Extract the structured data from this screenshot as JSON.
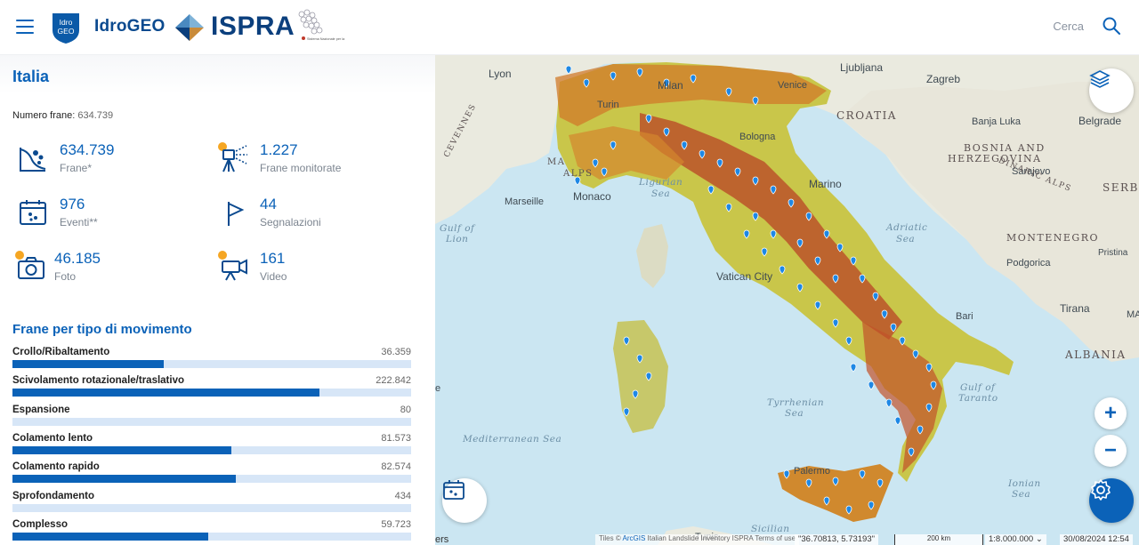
{
  "header": {
    "idrogeo_logo_text": [
      "Idro",
      "GEO"
    ],
    "app_name": "IdroGEO",
    "ispra_name": "ISPRA",
    "snpa_text": "Sistema Nazionale per la Protezione dell'Ambiente",
    "search_label": "Cerca"
  },
  "panel": {
    "region": "Italia",
    "total_label": "Numero frane",
    "total_value": "634.739",
    "stats": [
      {
        "icon": "landslide-icon",
        "value": "634.739",
        "label": "Frane*"
      },
      {
        "icon": "monitoring-icon",
        "value": "1.227",
        "label": "Frane monitorate"
      },
      {
        "icon": "calendar-events-icon",
        "value": "976",
        "label": "Eventi**"
      },
      {
        "icon": "flag-icon",
        "value": "44",
        "label": "Segnalazioni"
      },
      {
        "icon": "camera-icon",
        "value": "46.185",
        "label": "Foto"
      },
      {
        "icon": "video-camera-icon",
        "value": "161",
        "label": "Video"
      }
    ],
    "movement_title": "Frane per tipo di movimento",
    "movements": [
      {
        "name": "Crollo/Ribaltamento",
        "value": "36.359",
        "share": 0.38
      },
      {
        "name": "Scivolamento rotazionale/traslativo",
        "value": "222.842",
        "share": 0.77
      },
      {
        "name": "Espansione",
        "value": "80",
        "share": 0.0
      },
      {
        "name": "Colamento lento",
        "value": "81.573",
        "share": 0.55
      },
      {
        "name": "Colamento rapido",
        "value": "82.574",
        "share": 0.56
      },
      {
        "name": "Sprofondamento",
        "value": "434",
        "share": 0.0
      },
      {
        "name": "Complesso",
        "value": "59.723",
        "share": 0.49
      }
    ]
  },
  "map": {
    "places": [
      "Lyon",
      "Milan",
      "Venice",
      "Ljubljana",
      "Zagreb",
      "Turin",
      "Bologna",
      "Banja Luka",
      "Belgrade",
      "Marseille",
      "Monaco",
      "Sarajevo",
      "Marino",
      "Podgorica",
      "Pristina",
      "Vatican City",
      "Bari",
      "Tirana",
      "Palermo",
      "Tunis"
    ],
    "countries": [
      "CROATIA",
      "BOSNIA AND",
      "HERZEGOVINA",
      "SERB",
      "MONTENEGRO",
      "ALBANIA",
      "MA",
      "ALPS",
      "DINARIC ALPS",
      "CEVENNES"
    ],
    "seas": [
      "Ligurian",
      "Sea",
      "Adriatic",
      "Sea",
      "Gulf of",
      "Lion",
      "Tyrrhenian",
      "Sea",
      "Mediterranean Sea",
      "Gulf of",
      "Taranto",
      "Ionian",
      "Sea",
      "Sicilian"
    ],
    "attribution_prefix": "Tiles © ",
    "attribution_link": "ArcGIS",
    "attribution_suffix": " Italian Landslide Inventory ISPRA Terms of use",
    "coords": "\"36.70813, 5.73193\"",
    "scale": "200 km",
    "scale_ratio": "1:8.000.000",
    "date": "30/08/2024 12:54",
    "edge_label": "ers",
    "edge_label_left": "e",
    "edge_label_right": "MA"
  },
  "controls": {
    "zoom_in": "+",
    "zoom_out": "−"
  },
  "colors": {
    "primary": "#0b62b8",
    "bar_track": "#d7e6f7",
    "accent_orange": "#f5a623"
  }
}
